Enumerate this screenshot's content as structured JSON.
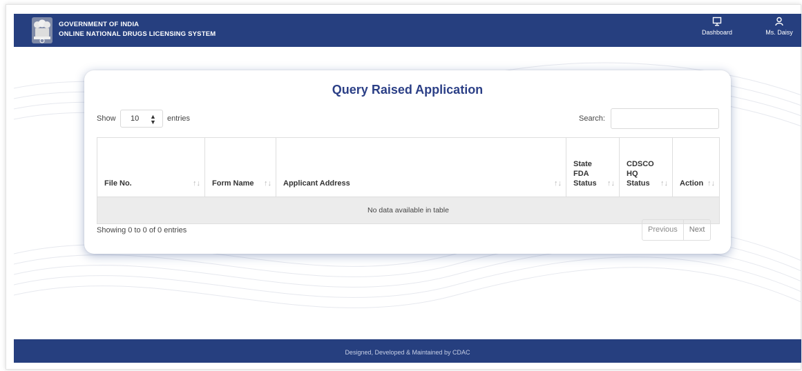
{
  "header": {
    "line1": "GOVERNMENT OF INDIA",
    "line2": "ONLINE NATIONAL DRUGS LICENSING SYSTEM",
    "nav": [
      {
        "label": "Dashboard",
        "icon": "monitor-icon"
      },
      {
        "label": "Ms. Daisy",
        "icon": "user-icon"
      }
    ]
  },
  "card": {
    "title": "Query Raised Application",
    "show_label": "Show",
    "entries_value": "10",
    "entries_label": "entries",
    "search_label": "Search:",
    "search_value": "",
    "columns": [
      {
        "line1": "File No.",
        "line2": "",
        "line3": ""
      },
      {
        "line1": "Form Name",
        "line2": "",
        "line3": ""
      },
      {
        "line1": "Applicant Address",
        "line2": "",
        "line3": ""
      },
      {
        "line1": "State",
        "line2": "FDA",
        "line3": "Status"
      },
      {
        "line1": "CDSCO",
        "line2": "HQ",
        "line3": "Status"
      },
      {
        "line1": "Action",
        "line2": "",
        "line3": ""
      }
    ],
    "empty_message": "No data available in table",
    "info": "Showing 0 to 0 of 0 entries",
    "pagination": {
      "previous": "Previous",
      "next": "Next"
    }
  },
  "footer": {
    "text": "Designed, Developed & Maintained by CDAC"
  },
  "colors": {
    "brand_navy": "#263f7f",
    "title_blue": "#2b3f86"
  }
}
